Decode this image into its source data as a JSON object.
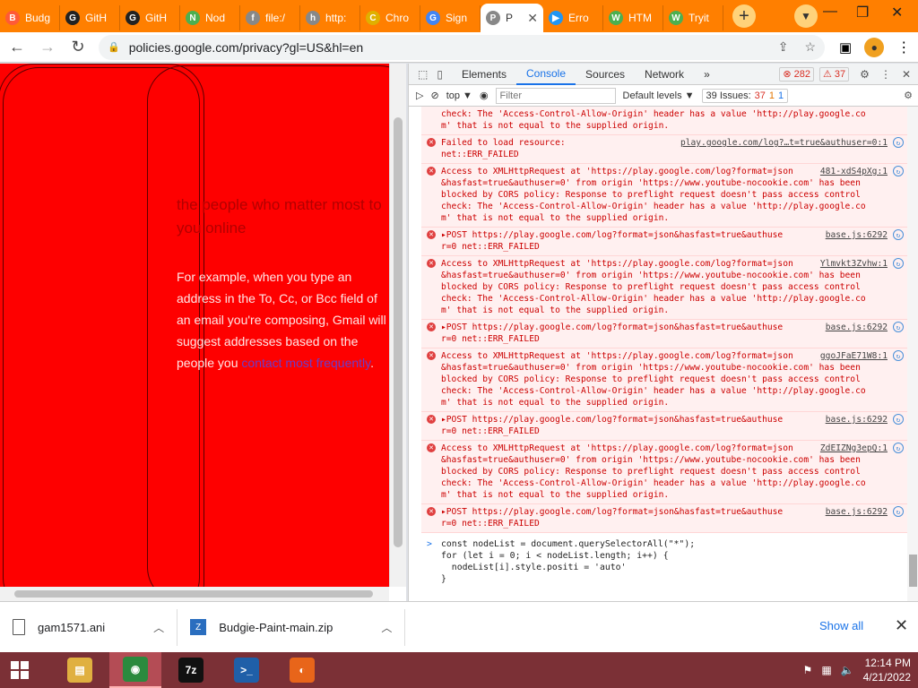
{
  "tabs": [
    {
      "label": "Budg",
      "color": "#ff5a36",
      "glyph": "B"
    },
    {
      "label": "GitH",
      "color": "#222222",
      "glyph": "G"
    },
    {
      "label": "GitH",
      "color": "#222222",
      "glyph": "G"
    },
    {
      "label": "Nod",
      "color": "#4caf50",
      "glyph": "N"
    },
    {
      "label": "file:/",
      "color": "#888888",
      "glyph": "f"
    },
    {
      "label": "http:",
      "color": "#888888",
      "glyph": "h"
    },
    {
      "label": "Chro",
      "color": "#e0b000",
      "glyph": "C"
    },
    {
      "label": "Sign",
      "color": "#4285f4",
      "glyph": "G"
    },
    {
      "label": "P",
      "color": "#888888",
      "glyph": "P",
      "active": true
    },
    {
      "label": "Erro",
      "color": "#2196f3",
      "glyph": "▶"
    },
    {
      "label": "HTM",
      "color": "#4caf50",
      "glyph": "W"
    },
    {
      "label": "Tryit",
      "color": "#4caf50",
      "glyph": "W"
    }
  ],
  "browser": {
    "url": "policies.google.com/privacy?gl=US&hl=en"
  },
  "page": {
    "heading": "the people who matter most to you online",
    "para_text": "For example, when you type an address in the To, Cc, or Bcc field of an email you're composing, Gmail will suggest addresses based on the people you ",
    "para_link": "contact most frequently",
    "para_end": "."
  },
  "devtools": {
    "tabs": [
      "Elements",
      "Console",
      "Sources",
      "Network",
      "»"
    ],
    "error_count": "282",
    "warn_count": "37",
    "context": "top ▼",
    "filter_placeholder": "Filter",
    "levels": "Default levels ▼",
    "issues_label": "39 Issues:",
    "issues_err": "37",
    "issues_warn": "1",
    "issues_info": "1"
  },
  "console": {
    "messages": [
      {
        "text": "check: The 'Access-Control-Allow-Origin' header has a value 'http://play.google.co\nm' that is not equal to the supplied origin.",
        "src": "",
        "icon": false
      },
      {
        "text": "Failed to load resource:\nnet::ERR_FAILED",
        "src": "play.google.com/log?…t=true&authuser=0:1",
        "icon": true
      },
      {
        "text": "Access to XMLHttpRequest at 'https://play.google.com/log?format=json\n&hasfast=true&authuser=0' from origin 'https://www.youtube-nocookie.com' has been\nblocked by CORS policy: Response to preflight request doesn't pass access control\ncheck: The 'Access-Control-Allow-Origin' header has a value 'http://play.google.co\nm' that is not equal to the supplied origin.",
        "src": "481-xdS4pXg:1",
        "icon": true
      },
      {
        "text": "▸POST https://play.google.com/log?format=json&hasfast=true&authuse\nr=0 net::ERR_FAILED",
        "src": "base.js:6292",
        "icon": true
      },
      {
        "text": "Access to XMLHttpRequest at 'https://play.google.com/log?format=json\n&hasfast=true&authuser=0' from origin 'https://www.youtube-nocookie.com' has been\nblocked by CORS policy: Response to preflight request doesn't pass access control\ncheck: The 'Access-Control-Allow-Origin' header has a value 'http://play.google.co\nm' that is not equal to the supplied origin.",
        "src": "Ylmvkt3Zvhw:1",
        "icon": true
      },
      {
        "text": "▸POST https://play.google.com/log?format=json&hasfast=true&authuse\nr=0 net::ERR_FAILED",
        "src": "base.js:6292",
        "icon": true
      },
      {
        "text": "Access to XMLHttpRequest at 'https://play.google.com/log?format=json\n&hasfast=true&authuser=0' from origin 'https://www.youtube-nocookie.com' has been\nblocked by CORS policy: Response to preflight request doesn't pass access control\ncheck: The 'Access-Control-Allow-Origin' header has a value 'http://play.google.co\nm' that is not equal to the supplied origin.",
        "src": "ggoJFaE71W8:1",
        "icon": true
      },
      {
        "text": "▸POST https://play.google.com/log?format=json&hasfast=true&authuse\nr=0 net::ERR_FAILED",
        "src": "base.js:6292",
        "icon": true
      },
      {
        "text": "Access to XMLHttpRequest at 'https://play.google.com/log?format=json\n&hasfast=true&authuser=0' from origin 'https://www.youtube-nocookie.com' has been\nblocked by CORS policy: Response to preflight request doesn't pass access control\ncheck: The 'Access-Control-Allow-Origin' header has a value 'http://play.google.co\nm' that is not equal to the supplied origin.",
        "src": "ZdEIZNg3epQ:1",
        "icon": true
      },
      {
        "text": "▸POST https://play.google.com/log?format=json&hasfast=true&authuse\nr=0 net::ERR_FAILED",
        "src": "base.js:6292",
        "icon": true
      }
    ],
    "prompt": "const nodeList = document.querySelectorAll(\"*\");\nfor (let i = 0; i < nodeList.length; i++) {\n  nodeList[i].style.positi = 'auto'\n}"
  },
  "downloads": {
    "items": [
      "gam1571.ani",
      "Budgie-Paint-main.zip"
    ],
    "show_all": "Show all"
  },
  "taskbar": {
    "apps": [
      {
        "name": "file-explorer",
        "color": "#e0b040",
        "glyph": "▤"
      },
      {
        "name": "chrome",
        "color": "#2b8a3e",
        "glyph": "◉",
        "active": true
      },
      {
        "name": "7zip",
        "color": "#111111",
        "glyph": "7z"
      },
      {
        "name": "powershell",
        "color": "#1f5fa8",
        "glyph": ">_"
      },
      {
        "name": "firefox",
        "color": "#e8651a",
        "glyph": "◐"
      }
    ],
    "time": "12:14 PM",
    "date": "4/21/2022"
  }
}
